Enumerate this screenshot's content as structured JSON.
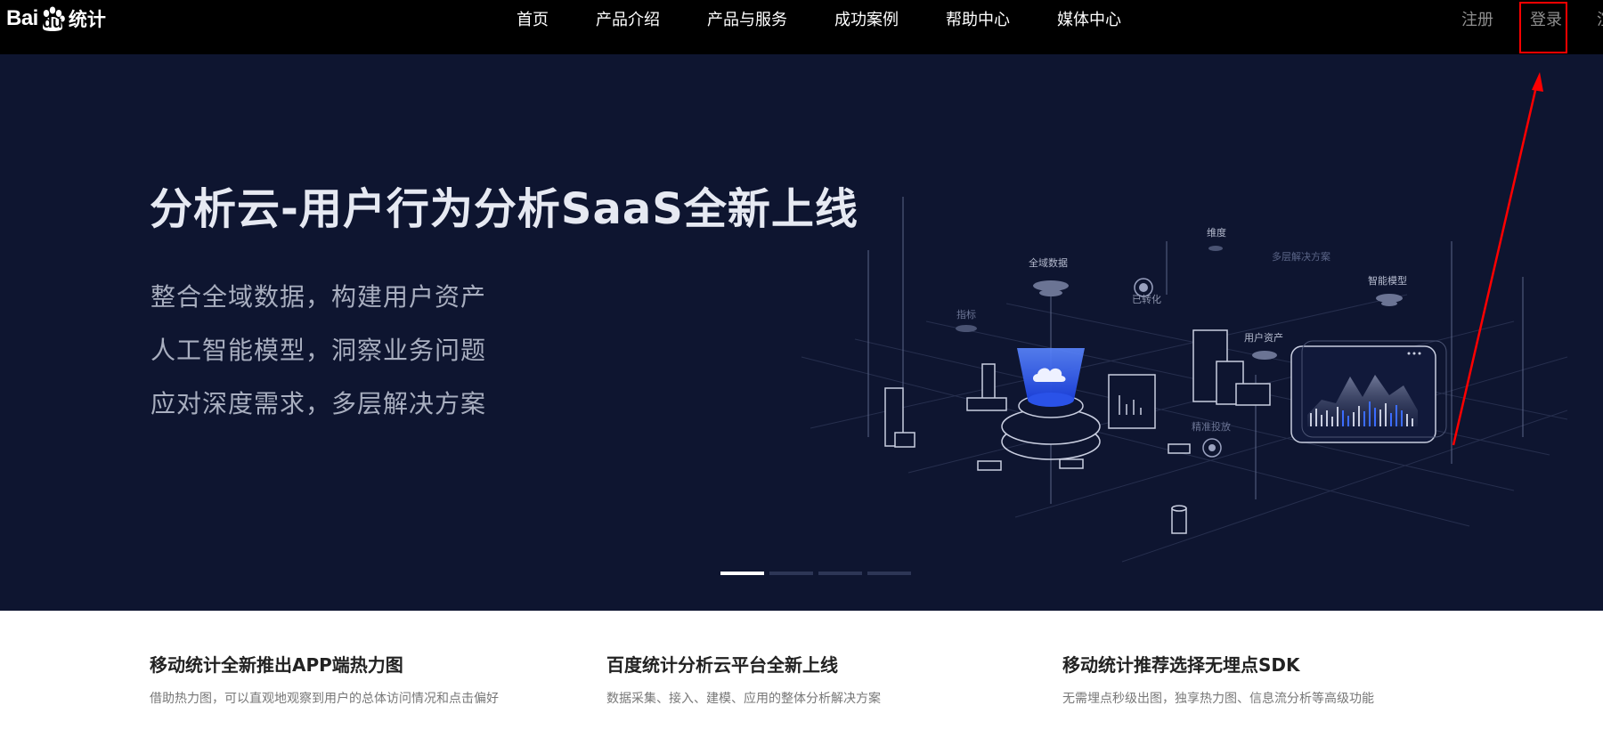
{
  "header": {
    "logo_text": "Bai",
    "logo_du": "du",
    "logo_product": "统计",
    "nav": [
      {
        "label": "首页"
      },
      {
        "label": "产品介绍"
      },
      {
        "label": "产品与服务"
      },
      {
        "label": "成功案例"
      },
      {
        "label": "帮助中心"
      },
      {
        "label": "媒体中心"
      }
    ],
    "register_label": "注册",
    "login_label": "登录",
    "overflow_label": "渲"
  },
  "hero": {
    "title": "分析云-用户行为分析SaaS全新上线",
    "subtitles": [
      "整合全域数据，构建用户资产",
      "人工智能模型，洞察业务问题",
      "应对深度需求，多层解决方案"
    ],
    "illustration_labels": {
      "all_data": "全域数据",
      "dimension": "维度",
      "multi_solution": "多层解决方案",
      "smart_model": "智能模型",
      "indicator": "指标",
      "converted": "已转化",
      "user_assets": "用户资产",
      "precise_delivery": "精准投放"
    },
    "carousel": {
      "count": 4,
      "active_index": 0
    },
    "bg_color": "#0e1530",
    "accent_blue": "#3b6cff"
  },
  "annotation": {
    "color": "#ff0000",
    "target": "登录"
  },
  "news": [
    {
      "title": "移动统计全新推出APP端热力图",
      "desc": "借助热力图，可以直观地观察到用户的总体访问情况和点击偏好"
    },
    {
      "title": "百度统计分析云平台全新上线",
      "desc": "数据采集、接入、建模、应用的整体分析解决方案"
    },
    {
      "title": "移动统计推荐选择无埋点SDK",
      "desc": "无需埋点秒级出图，独享热力图、信息流分析等高级功能"
    }
  ]
}
